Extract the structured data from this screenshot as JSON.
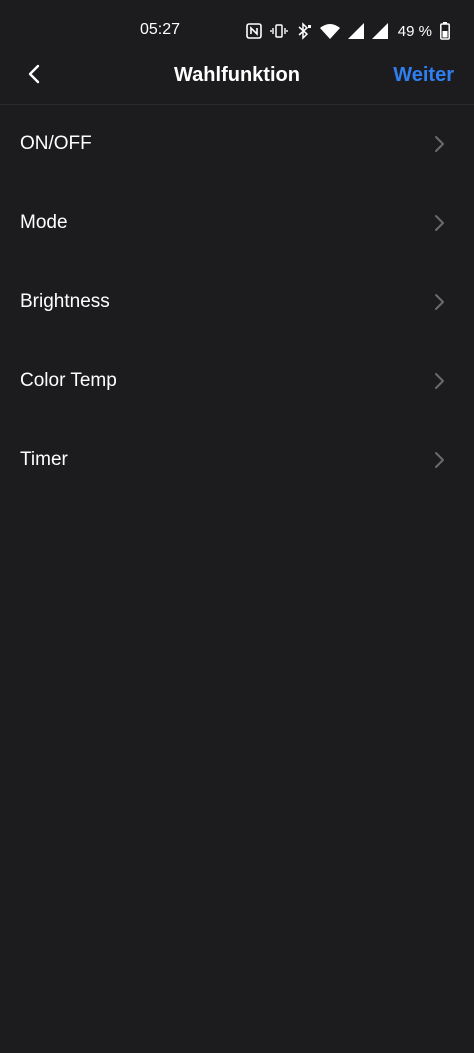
{
  "status_bar": {
    "time": "05:27",
    "battery_percent": "49 %",
    "icons": [
      "nfc-icon",
      "vibrate-icon",
      "bluetooth-icon",
      "wifi-icon",
      "signal-icon",
      "signal-icon",
      "battery-icon"
    ]
  },
  "header": {
    "title": "Wahlfunktion",
    "next_label": "Weiter",
    "back_icon": "chevron-left-icon"
  },
  "colors": {
    "background": "#1c1c1e",
    "accent": "#2f7ff1",
    "text": "#ffffff",
    "chevron": "#6b6b6e"
  },
  "functions": [
    {
      "label": "ON/OFF"
    },
    {
      "label": "Mode"
    },
    {
      "label": "Brightness"
    },
    {
      "label": "Color Temp"
    },
    {
      "label": "Timer"
    }
  ]
}
